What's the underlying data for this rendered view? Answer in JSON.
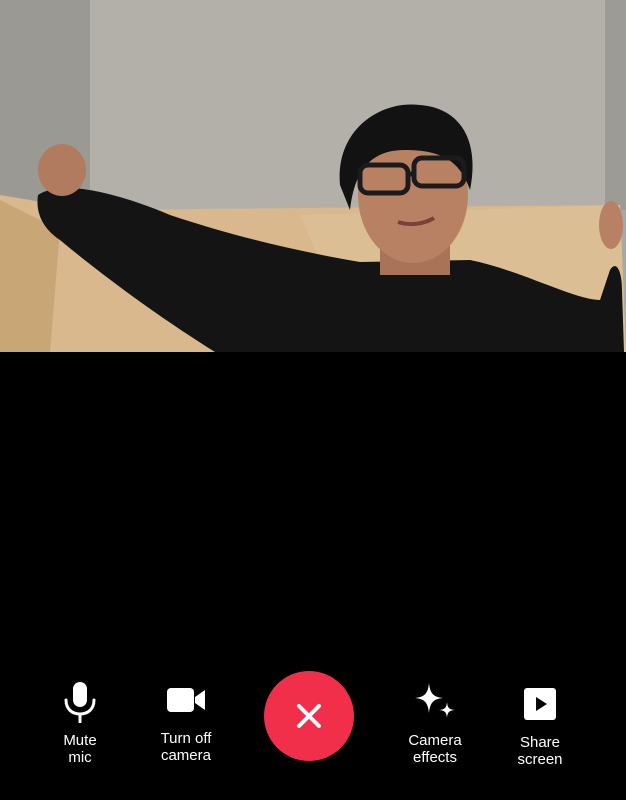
{
  "video": {
    "content": "self-view camera feed"
  },
  "controls": {
    "mute": {
      "label": "Mute\nmic",
      "icon": "microphone-icon"
    },
    "camera": {
      "label": "Turn off\ncamera",
      "icon": "video-camera-icon"
    },
    "end_call": {
      "icon": "close-icon",
      "color": "#f22f4b"
    },
    "effects": {
      "label": "Camera\neffects",
      "icon": "sparkles-icon"
    },
    "share": {
      "label": "Share\nscreen",
      "icon": "share-screen-icon"
    }
  },
  "colors": {
    "background": "#000000",
    "end_call": "#f22f4b",
    "icon": "#ffffff"
  }
}
